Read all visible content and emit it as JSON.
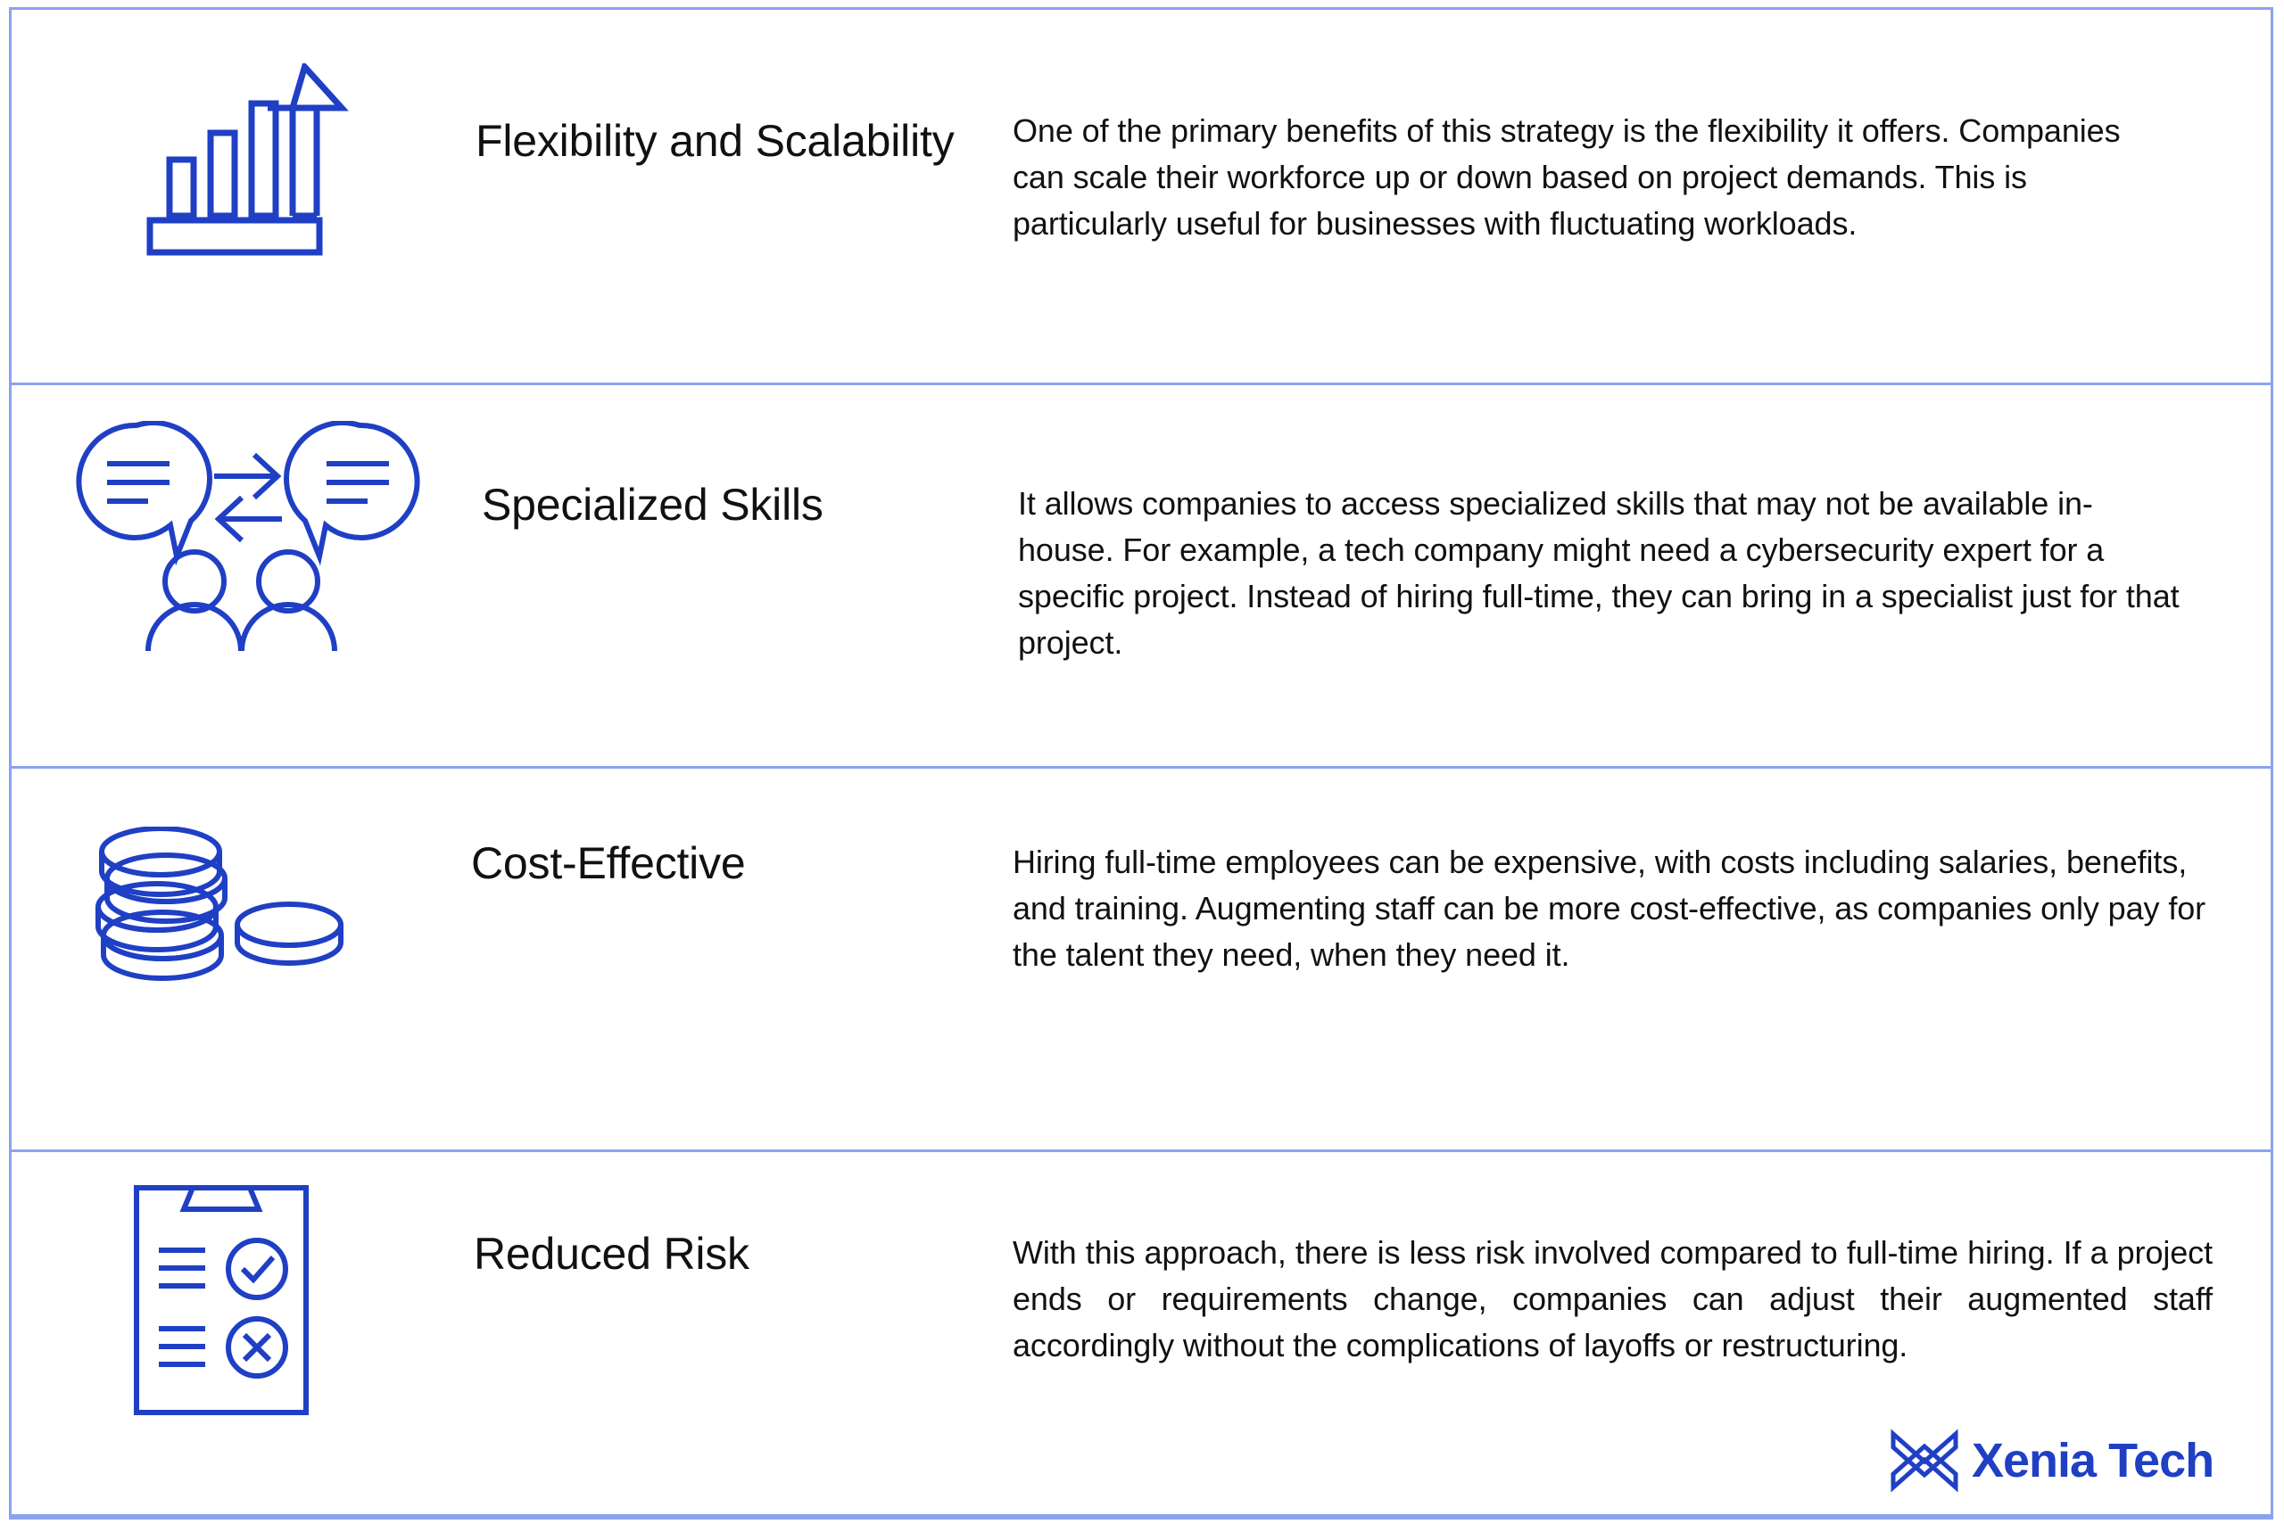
{
  "theme": {
    "accent_blue": "#1f3fc4",
    "divider_blue": "#8da2ef",
    "text_black": "#111111",
    "background": "#ffffff"
  },
  "rows": [
    {
      "icon": "growth-bar-chart-arrow-icon",
      "heading": "Flexibility and Scalability",
      "body": "One of the primary benefits of this strategy is the flexibility it offers. Companies can scale their workforce up or down based on project demands. This is particularly useful for businesses with fluctuating workloads."
    },
    {
      "icon": "two-people-speech-bubbles-exchange-icon",
      "heading": "Specialized Skills",
      "body": "It allows companies to access specialized skills that may not be available in-house. For example, a tech company might need a cybersecurity expert for a specific project. Instead of hiring full-time, they can bring in a specialist just for that project."
    },
    {
      "icon": "coin-stack-icon",
      "heading": "Cost-Effective",
      "body": "Hiring full-time employees can be expensive, with costs including salaries, benefits, and training. Augmenting staff can be more cost-effective, as companies only pay for the talent they need, when they need it."
    },
    {
      "icon": "clipboard-checklist-check-cross-icon",
      "heading": "Reduced Risk",
      "body": "With this approach, there is less risk involved compared to full-time hiring. If a project ends or requirements change, companies can adjust their augmented staff accordingly without the complications of layoffs or restructuring."
    }
  ],
  "logo": {
    "mark": "xenia-x-mark-icon",
    "text": "Xenia Tech"
  }
}
